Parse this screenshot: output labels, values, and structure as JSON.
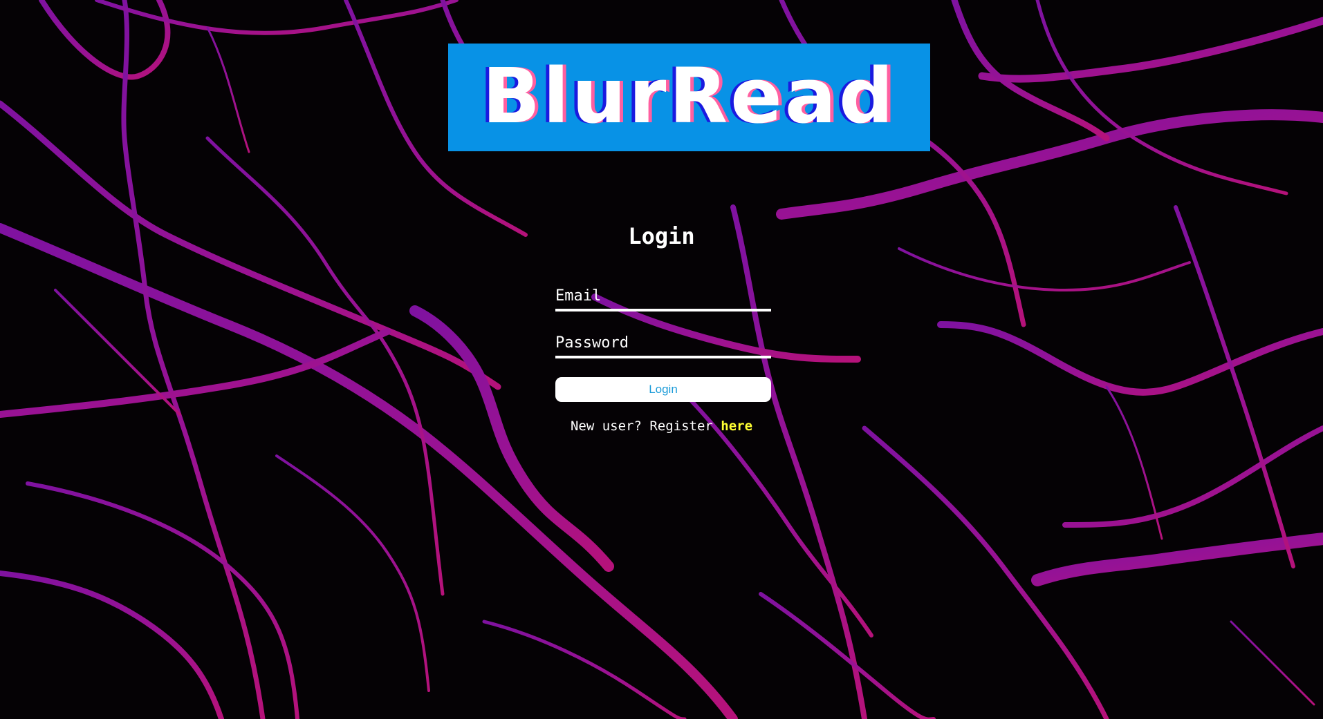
{
  "app": {
    "logo_text": "BlurRead"
  },
  "login_form": {
    "title": "Login",
    "email": {
      "placeholder": "Email",
      "value": ""
    },
    "password": {
      "placeholder": "Password",
      "value": ""
    },
    "submit_label": "Login",
    "register_prompt": "New user? Register",
    "register_link_label": "here"
  },
  "colors": {
    "background": "#050205",
    "crack_primary": "#8e1296",
    "crack_secondary": "#b0127e",
    "logo_background": "#0892e6",
    "logo_text": "#ffffff",
    "logo_shadow_left": "#1a1ae0",
    "logo_shadow_right": "#ff5fa0",
    "button_text": "#1a9bd8",
    "link": "#ffff33"
  }
}
